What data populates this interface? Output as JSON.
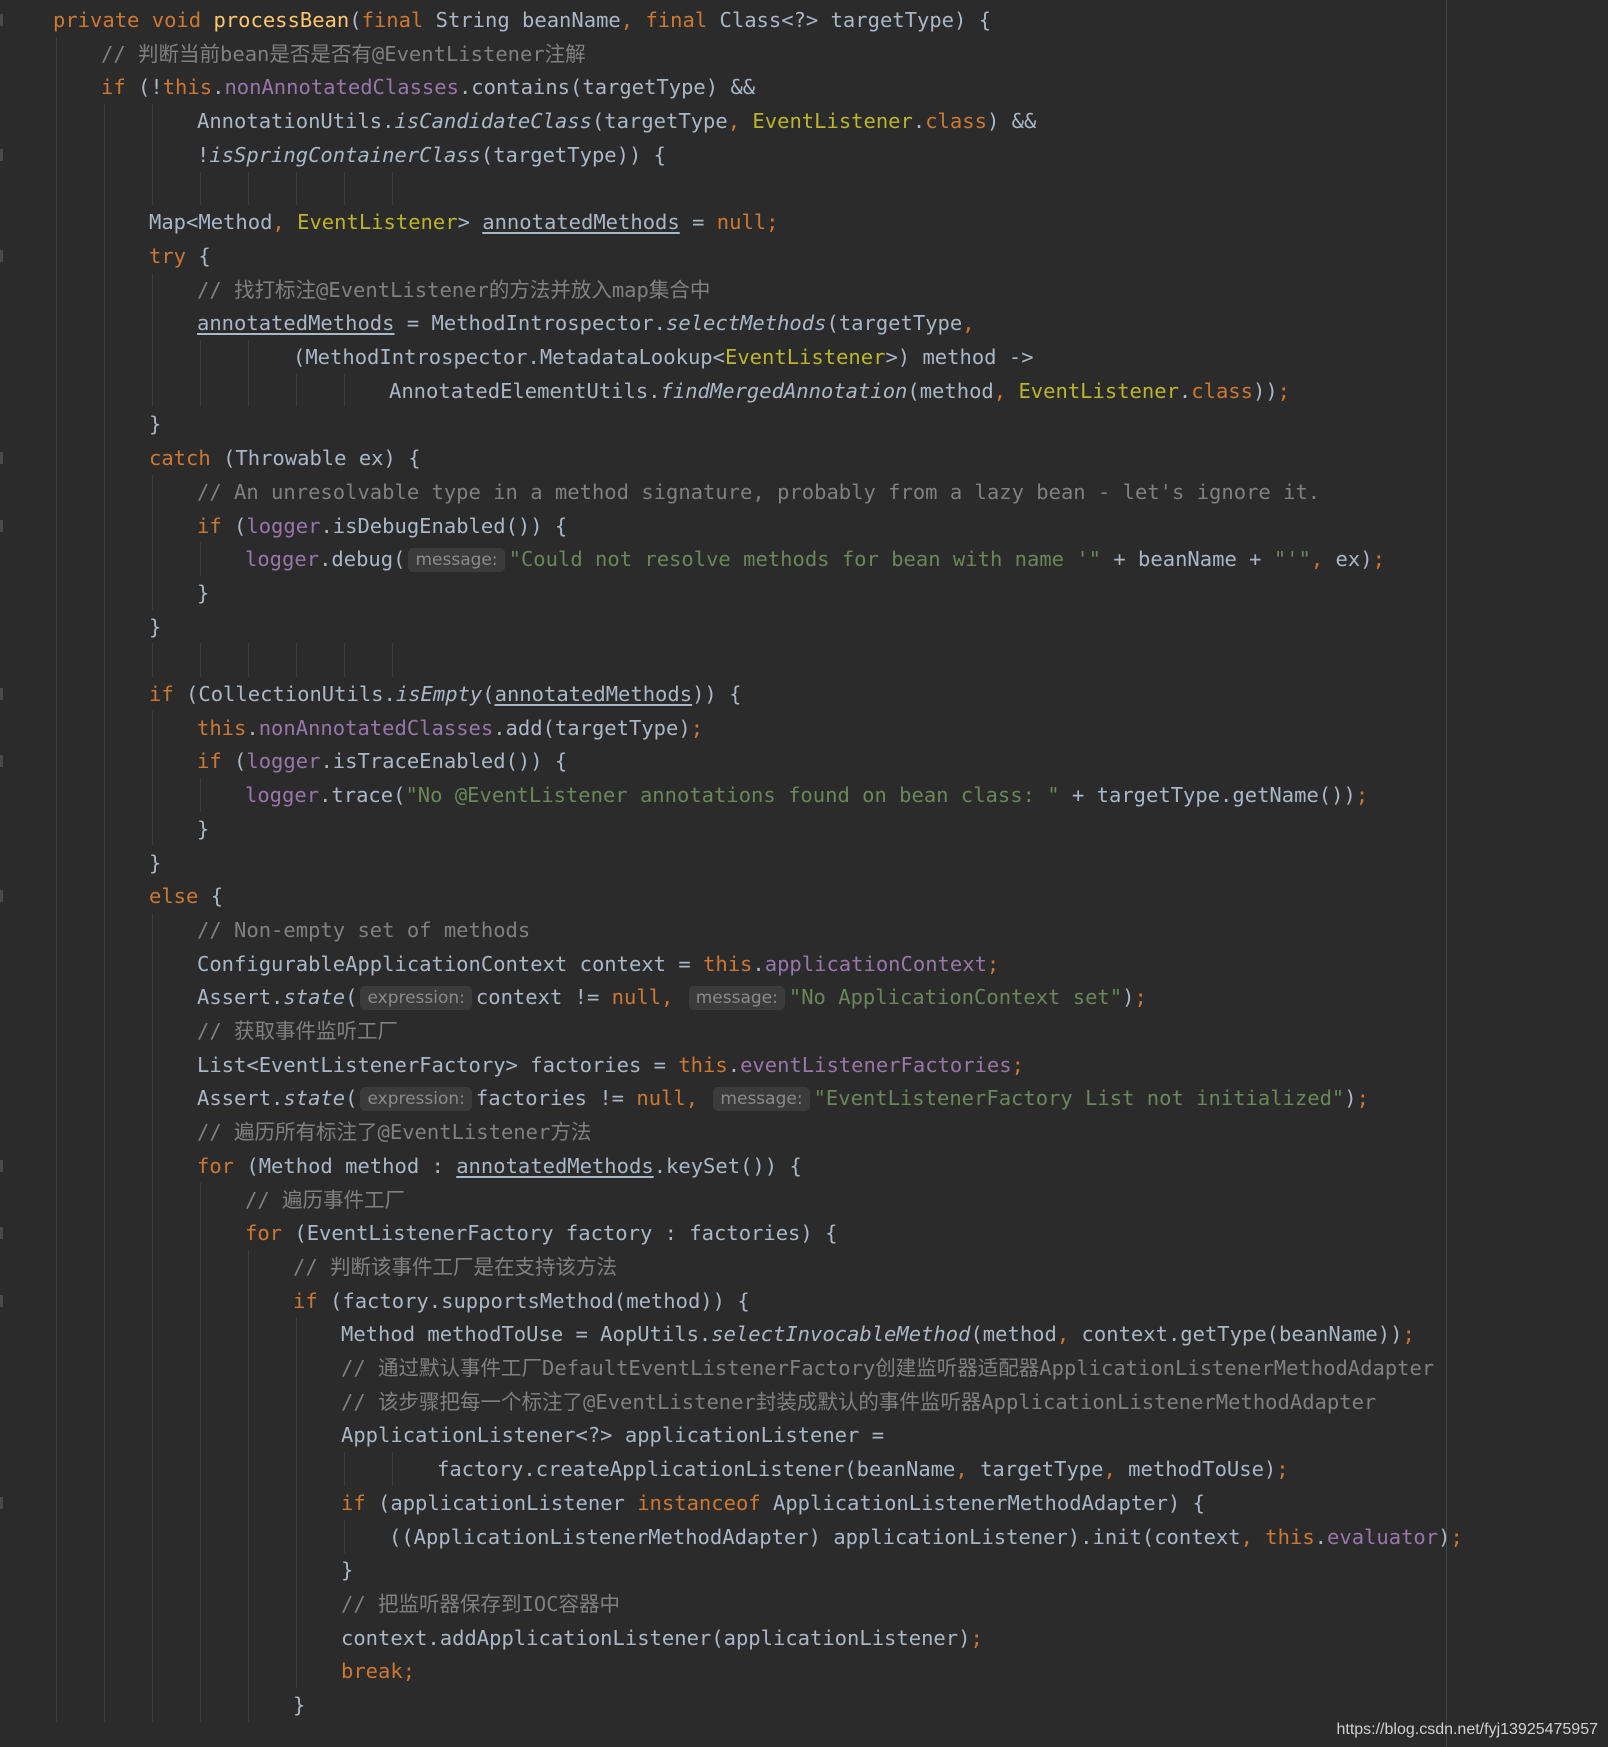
{
  "editor": {
    "colors": {
      "background": "#2b2b2b",
      "default_text": "#a9b7c6",
      "keyword": "#cc7832",
      "string": "#6a8759",
      "comment": "#808080",
      "field": "#9876aa",
      "method_declaration": "#ffc66d",
      "annotation_type": "#bbb529"
    },
    "lines": [
      {
        "indent": 1,
        "tokens": [
          {
            "t": "private void ",
            "c": "kw"
          },
          {
            "t": "processBean",
            "c": "fn"
          },
          {
            "t": "("
          },
          {
            "t": "final ",
            "c": "kw"
          },
          {
            "t": "String beanName"
          },
          {
            "t": ", ",
            "c": "kw"
          },
          {
            "t": "final ",
            "c": "kw"
          },
          {
            "t": "Class<?> targetType) {"
          }
        ]
      },
      {
        "indent": 2,
        "tokens": [
          {
            "t": "// 判断当前bean是否是否有@EventListener注解",
            "c": "cmt"
          }
        ]
      },
      {
        "indent": 2,
        "tokens": [
          {
            "t": "if ",
            "c": "kw"
          },
          {
            "t": "(!"
          },
          {
            "t": "this",
            "c": "kw"
          },
          {
            "t": "."
          },
          {
            "t": "nonAnnotatedClasses",
            "c": "field"
          },
          {
            "t": ".contains(targetType) &&"
          }
        ]
      },
      {
        "indent": 4,
        "tokens": [
          {
            "t": "AnnotationUtils."
          },
          {
            "t": "isCandidateClass",
            "c": "italic"
          },
          {
            "t": "(targetType"
          },
          {
            "t": ", ",
            "c": "kw"
          },
          {
            "t": "EventListener",
            "c": "ann"
          },
          {
            "t": "."
          },
          {
            "t": "class",
            "c": "kw"
          },
          {
            "t": ") &&"
          }
        ]
      },
      {
        "indent": 4,
        "tokens": [
          {
            "t": "!"
          },
          {
            "t": "isSpringContainerClass",
            "c": "italic"
          },
          {
            "t": "(targetType)) {"
          }
        ]
      },
      {
        "indent": 0,
        "tokens": []
      },
      {
        "indent": 3,
        "tokens": [
          {
            "t": "Map<Method"
          },
          {
            "t": ", ",
            "c": "kw"
          },
          {
            "t": "EventListener",
            "c": "ann"
          },
          {
            "t": "> "
          },
          {
            "t": "annotatedMethods",
            "c": "u"
          },
          {
            "t": " = "
          },
          {
            "t": "null;",
            "c": "kw"
          }
        ]
      },
      {
        "indent": 3,
        "tokens": [
          {
            "t": "try ",
            "c": "kw"
          },
          {
            "t": "{"
          }
        ]
      },
      {
        "indent": 4,
        "tokens": [
          {
            "t": "// 找打标注@EventListener的方法并放入map集合中",
            "c": "cmt"
          }
        ]
      },
      {
        "indent": 4,
        "tokens": [
          {
            "t": "annotatedMethods",
            "c": "u"
          },
          {
            "t": " = MethodIntrospector."
          },
          {
            "t": "selectMethods",
            "c": "italic"
          },
          {
            "t": "(targetType"
          },
          {
            "t": ",",
            "c": "kw"
          }
        ]
      },
      {
        "indent": 6,
        "tokens": [
          {
            "t": "(MethodIntrospector.MetadataLookup<"
          },
          {
            "t": "EventListener",
            "c": "ann"
          },
          {
            "t": ">) method ->"
          }
        ]
      },
      {
        "indent": 8,
        "tokens": [
          {
            "t": "AnnotatedElementUtils."
          },
          {
            "t": "findMergedAnnotation",
            "c": "italic"
          },
          {
            "t": "(method"
          },
          {
            "t": ", ",
            "c": "kw"
          },
          {
            "t": "EventListener",
            "c": "ann"
          },
          {
            "t": "."
          },
          {
            "t": "class",
            "c": "kw"
          },
          {
            "t": "))"
          },
          {
            "t": ";",
            "c": "kw"
          }
        ]
      },
      {
        "indent": 3,
        "tokens": [
          {
            "t": "}"
          }
        ]
      },
      {
        "indent": 3,
        "tokens": [
          {
            "t": "catch ",
            "c": "kw"
          },
          {
            "t": "(Throwable ex) {"
          }
        ]
      },
      {
        "indent": 4,
        "tokens": [
          {
            "t": "// An unresolvable type in a method signature, probably from a lazy bean - let's ignore it.",
            "c": "cmt"
          }
        ]
      },
      {
        "indent": 4,
        "tokens": [
          {
            "t": "if ",
            "c": "kw"
          },
          {
            "t": "("
          },
          {
            "t": "logger",
            "c": "field"
          },
          {
            "t": ".isDebugEnabled()) {"
          }
        ]
      },
      {
        "indent": 5,
        "tokens": [
          {
            "t": "logger",
            "c": "field"
          },
          {
            "t": ".debug("
          },
          {
            "t": "message:",
            "c": "hint"
          },
          {
            "t": "\"Could not resolve methods for bean with name '\"",
            "c": "str"
          },
          {
            "t": " + beanName + "
          },
          {
            "t": "\"'\"",
            "c": "str"
          },
          {
            "t": ", ",
            "c": "kw"
          },
          {
            "t": "ex)"
          },
          {
            "t": ";",
            "c": "kw"
          }
        ]
      },
      {
        "indent": 4,
        "tokens": [
          {
            "t": "}"
          }
        ]
      },
      {
        "indent": 3,
        "tokens": [
          {
            "t": "}"
          }
        ]
      },
      {
        "indent": 0,
        "tokens": []
      },
      {
        "indent": 3,
        "tokens": [
          {
            "t": "if ",
            "c": "kw"
          },
          {
            "t": "(CollectionUtils."
          },
          {
            "t": "isEmpty",
            "c": "italic"
          },
          {
            "t": "("
          },
          {
            "t": "annotatedMethods",
            "c": "u"
          },
          {
            "t": ")) {"
          }
        ]
      },
      {
        "indent": 4,
        "tokens": [
          {
            "t": "this",
            "c": "kw"
          },
          {
            "t": "."
          },
          {
            "t": "nonAnnotatedClasses",
            "c": "field"
          },
          {
            "t": ".add(targetType)"
          },
          {
            "t": ";",
            "c": "kw"
          }
        ]
      },
      {
        "indent": 4,
        "tokens": [
          {
            "t": "if ",
            "c": "kw"
          },
          {
            "t": "("
          },
          {
            "t": "logger",
            "c": "field"
          },
          {
            "t": ".isTraceEnabled()) {"
          }
        ]
      },
      {
        "indent": 5,
        "tokens": [
          {
            "t": "logger",
            "c": "field"
          },
          {
            "t": ".trace("
          },
          {
            "t": "\"No @EventListener annotations found on bean class: \"",
            "c": "str"
          },
          {
            "t": " + targetType.getName())"
          },
          {
            "t": ";",
            "c": "kw"
          }
        ]
      },
      {
        "indent": 4,
        "tokens": [
          {
            "t": "}"
          }
        ]
      },
      {
        "indent": 3,
        "tokens": [
          {
            "t": "}"
          }
        ]
      },
      {
        "indent": 3,
        "tokens": [
          {
            "t": "else ",
            "c": "kw"
          },
          {
            "t": "{"
          }
        ]
      },
      {
        "indent": 4,
        "tokens": [
          {
            "t": "// Non-empty set of methods",
            "c": "cmt"
          }
        ]
      },
      {
        "indent": 4,
        "tokens": [
          {
            "t": "ConfigurableApplicationContext context = "
          },
          {
            "t": "this",
            "c": "kw"
          },
          {
            "t": "."
          },
          {
            "t": "applicationContext",
            "c": "field"
          },
          {
            "t": ";",
            "c": "kw"
          }
        ]
      },
      {
        "indent": 4,
        "tokens": [
          {
            "t": "Assert."
          },
          {
            "t": "state",
            "c": "italic"
          },
          {
            "t": "("
          },
          {
            "t": "expression:",
            "c": "hint"
          },
          {
            "t": "context != "
          },
          {
            "t": "null, ",
            "c": "kw"
          },
          {
            "t": "message:",
            "c": "hint"
          },
          {
            "t": "\"No ApplicationContext set\"",
            "c": "str"
          },
          {
            "t": ")"
          },
          {
            "t": ";",
            "c": "kw"
          }
        ]
      },
      {
        "indent": 4,
        "tokens": [
          {
            "t": "// 获取事件监听工厂",
            "c": "cmt"
          }
        ]
      },
      {
        "indent": 4,
        "tokens": [
          {
            "t": "List<EventListenerFactory> factories = "
          },
          {
            "t": "this",
            "c": "kw"
          },
          {
            "t": "."
          },
          {
            "t": "eventListenerFactories",
            "c": "field"
          },
          {
            "t": ";",
            "c": "kw"
          }
        ]
      },
      {
        "indent": 4,
        "tokens": [
          {
            "t": "Assert."
          },
          {
            "t": "state",
            "c": "italic"
          },
          {
            "t": "("
          },
          {
            "t": "expression:",
            "c": "hint"
          },
          {
            "t": "factories != "
          },
          {
            "t": "null, ",
            "c": "kw"
          },
          {
            "t": "message:",
            "c": "hint"
          },
          {
            "t": "\"EventListenerFactory List not initialized\"",
            "c": "str"
          },
          {
            "t": ")"
          },
          {
            "t": ";",
            "c": "kw"
          }
        ]
      },
      {
        "indent": 4,
        "tokens": [
          {
            "t": "// 遍历所有标注了@EventListener方法",
            "c": "cmt"
          }
        ]
      },
      {
        "indent": 4,
        "tokens": [
          {
            "t": "for ",
            "c": "kw"
          },
          {
            "t": "(Method method : "
          },
          {
            "t": "annotatedMethods",
            "c": "u"
          },
          {
            "t": ".keySet()) {"
          }
        ]
      },
      {
        "indent": 5,
        "tokens": [
          {
            "t": "// 遍历事件工厂",
            "c": "cmt"
          }
        ]
      },
      {
        "indent": 5,
        "tokens": [
          {
            "t": "for ",
            "c": "kw"
          },
          {
            "t": "(EventListenerFactory factory : factories) {"
          }
        ]
      },
      {
        "indent": 6,
        "tokens": [
          {
            "t": "// 判断该事件工厂是在支持该方法",
            "c": "cmt"
          }
        ]
      },
      {
        "indent": 6,
        "tokens": [
          {
            "t": "if ",
            "c": "kw"
          },
          {
            "t": "(factory.supportsMethod(method)) {"
          }
        ]
      },
      {
        "indent": 7,
        "tokens": [
          {
            "t": "Method methodToUse = AopUtils."
          },
          {
            "t": "selectInvocableMethod",
            "c": "italic"
          },
          {
            "t": "(method"
          },
          {
            "t": ", ",
            "c": "kw"
          },
          {
            "t": "context.getType(beanName))"
          },
          {
            "t": ";",
            "c": "kw"
          }
        ]
      },
      {
        "indent": 7,
        "tokens": [
          {
            "t": "// 通过默认事件工厂DefaultEventListenerFactory创建监听器适配器ApplicationListenerMethodAdapter",
            "c": "cmt"
          }
        ]
      },
      {
        "indent": 7,
        "tokens": [
          {
            "t": "// 该步骤把每一个标注了@EventListener封装成默认的事件监听器ApplicationListenerMethodAdapter",
            "c": "cmt"
          }
        ]
      },
      {
        "indent": 7,
        "tokens": [
          {
            "t": "ApplicationListener<?> applicationListener ="
          }
        ]
      },
      {
        "indent": 9,
        "tokens": [
          {
            "t": "factory.createApplicationListener(beanName"
          },
          {
            "t": ", ",
            "c": "kw"
          },
          {
            "t": "targetType"
          },
          {
            "t": ", ",
            "c": "kw"
          },
          {
            "t": "methodToUse)"
          },
          {
            "t": ";",
            "c": "kw"
          }
        ]
      },
      {
        "indent": 7,
        "tokens": [
          {
            "t": "if ",
            "c": "kw"
          },
          {
            "t": "(applicationListener "
          },
          {
            "t": "instanceof ",
            "c": "kw"
          },
          {
            "t": "ApplicationListenerMethodAdapter) {"
          }
        ]
      },
      {
        "indent": 8,
        "tokens": [
          {
            "t": "((ApplicationListenerMethodAdapter) applicationListener).init(context"
          },
          {
            "t": ", ",
            "c": "kw"
          },
          {
            "t": "this",
            "c": "kw"
          },
          {
            "t": "."
          },
          {
            "t": "evaluator",
            "c": "field"
          },
          {
            "t": ")"
          },
          {
            "t": ";",
            "c": "kw"
          }
        ]
      },
      {
        "indent": 7,
        "tokens": [
          {
            "t": "}"
          }
        ]
      },
      {
        "indent": 7,
        "tokens": [
          {
            "t": "// 把监听器保存到IOC容器中",
            "c": "cmt"
          }
        ]
      },
      {
        "indent": 7,
        "tokens": [
          {
            "t": "context.addApplicationListener(applicationListener)"
          },
          {
            "t": ";",
            "c": "kw"
          }
        ]
      },
      {
        "indent": 7,
        "tokens": [
          {
            "t": "break;",
            "c": "kw"
          }
        ]
      },
      {
        "indent": 6,
        "tokens": [
          {
            "t": "}"
          }
        ]
      }
    ]
  },
  "watermark": "https://blog.csdn.net/fyj13925475957"
}
